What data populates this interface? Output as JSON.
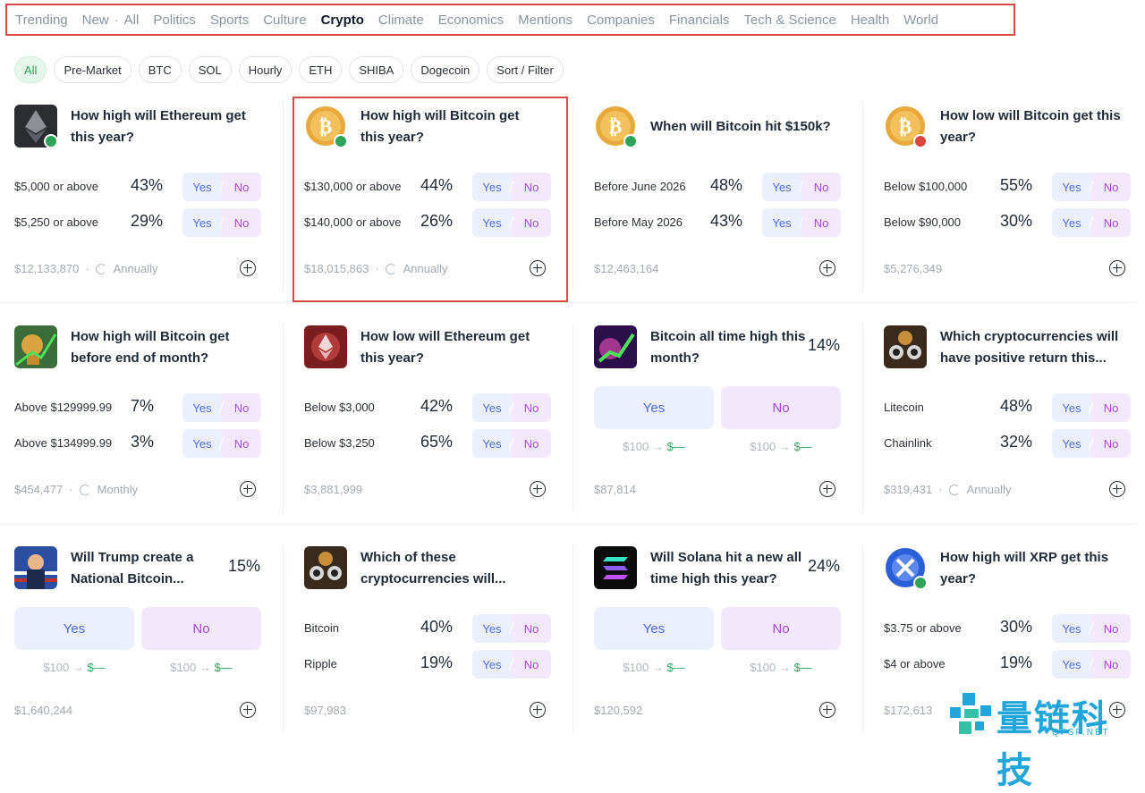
{
  "nav": {
    "items": [
      "Trending",
      "New",
      "·",
      "All",
      "Politics",
      "Sports",
      "Culture",
      "Crypto",
      "Climate",
      "Economics",
      "Mentions",
      "Companies",
      "Financials",
      "Tech & Science",
      "Health",
      "World"
    ],
    "active": "Crypto"
  },
  "chips": [
    "All",
    "Pre-Market",
    "BTC",
    "SOL",
    "Hourly",
    "ETH",
    "SHIBA",
    "Dogecoin",
    "Sort / Filter"
  ],
  "cards": [
    {
      "title": "How high will Ethereum get this year?",
      "icon": "ethereum-icon",
      "type": "rows",
      "rows": [
        {
          "label": "$5,000 or above",
          "pct": "43%"
        },
        {
          "label": "$5,250 or above",
          "pct": "29%"
        }
      ],
      "volume": "$12,133,870",
      "recurrence": "Annually"
    },
    {
      "title": "How high will Bitcoin get this year?",
      "icon": "bitcoin-icon",
      "type": "rows",
      "rows": [
        {
          "label": "$130,000 or above",
          "pct": "44%"
        },
        {
          "label": "$140,000 or above",
          "pct": "26%"
        }
      ],
      "volume": "$18,015,863",
      "recurrence": "Annually"
    },
    {
      "title": "When will Bitcoin hit $150k?",
      "icon": "bitcoin-icon",
      "type": "rows",
      "rows": [
        {
          "label": "Before June 2026",
          "pct": "48%"
        },
        {
          "label": "Before May 2026",
          "pct": "43%"
        }
      ],
      "volume": "$12,463,164",
      "recurrence": ""
    },
    {
      "title": "How low will Bitcoin get this year?",
      "icon": "bitcoin-icon",
      "type": "rows",
      "rows": [
        {
          "label": "Below $100,000",
          "pct": "55%"
        },
        {
          "label": "Below $90,000",
          "pct": "30%"
        }
      ],
      "volume": "$5,276,349",
      "recurrence": ""
    },
    {
      "title": "How high will Bitcoin get before end of month?",
      "icon": "bitcoin-trophy-icon",
      "type": "rows",
      "rows": [
        {
          "label": "Above $129999.99",
          "pct": "7%"
        },
        {
          "label": "Above $134999.99",
          "pct": "3%"
        }
      ],
      "volume": "$454,477",
      "recurrence": "Monthly"
    },
    {
      "title": "How low will Ethereum get this year?",
      "icon": "ethereum-red-icon",
      "type": "rows",
      "rows": [
        {
          "label": "Below $3,000",
          "pct": "42%"
        },
        {
          "label": "Below $3,250",
          "pct": "65%"
        }
      ],
      "volume": "$3,881,999",
      "recurrence": ""
    },
    {
      "title": "Bitcoin all time high this month?",
      "icon": "bitcoin-chart-icon",
      "type": "binary",
      "pct": "14%",
      "yes": "Yes",
      "no": "No",
      "payout_yes": "$100 → ",
      "payout_no": "$100 → ",
      "payout_val": "$—",
      "volume": "$87,814",
      "recurrence": ""
    },
    {
      "title": "Which cryptocurrencies will have positive return this...",
      "icon": "crypto-coins-icon",
      "type": "rows",
      "rows": [
        {
          "label": "Litecoin",
          "pct": "48%"
        },
        {
          "label": "Chainlink",
          "pct": "32%"
        }
      ],
      "volume": "$319,431",
      "recurrence": "Annually"
    },
    {
      "title": "Will Trump create a National Bitcoin...",
      "icon": "trump-flag-icon",
      "type": "binary",
      "pct": "15%",
      "yes": "Yes",
      "no": "No",
      "payout_yes": "$100 → ",
      "payout_no": "$100 → ",
      "payout_val": "$—",
      "volume": "$1,640,244",
      "recurrence": ""
    },
    {
      "title": "Which of these cryptocurrencies will...",
      "icon": "crypto-coins-icon",
      "type": "rows",
      "rows": [
        {
          "label": "Bitcoin",
          "pct": "40%"
        },
        {
          "label": "Ripple",
          "pct": "19%"
        }
      ],
      "volume": "$97,983",
      "recurrence": ""
    },
    {
      "title": "Will Solana hit a new all time high this year?",
      "icon": "solana-icon",
      "type": "binary",
      "pct": "24%",
      "yes": "Yes",
      "no": "No",
      "payout_yes": "$100 → ",
      "payout_no": "$100 → ",
      "payout_val": "$—",
      "volume": "$120,592",
      "recurrence": ""
    },
    {
      "title": "How high will XRP get this year?",
      "icon": "xrp-icon",
      "type": "rows",
      "rows": [
        {
          "label": "$3.75 or above",
          "pct": "30%"
        },
        {
          "label": "$4 or above",
          "pct": "19%"
        }
      ],
      "volume": "$172,613",
      "recurrence": ""
    }
  ],
  "yes_label": "Yes",
  "no_label": "No",
  "watermark": {
    "text": "量链科技",
    "sub": "QFSP.NET"
  },
  "colors": {
    "highlight": "#d94a45",
    "yes": "#4f6ae6",
    "no": "#a64ad9",
    "accent_green": "#2fa35a"
  }
}
